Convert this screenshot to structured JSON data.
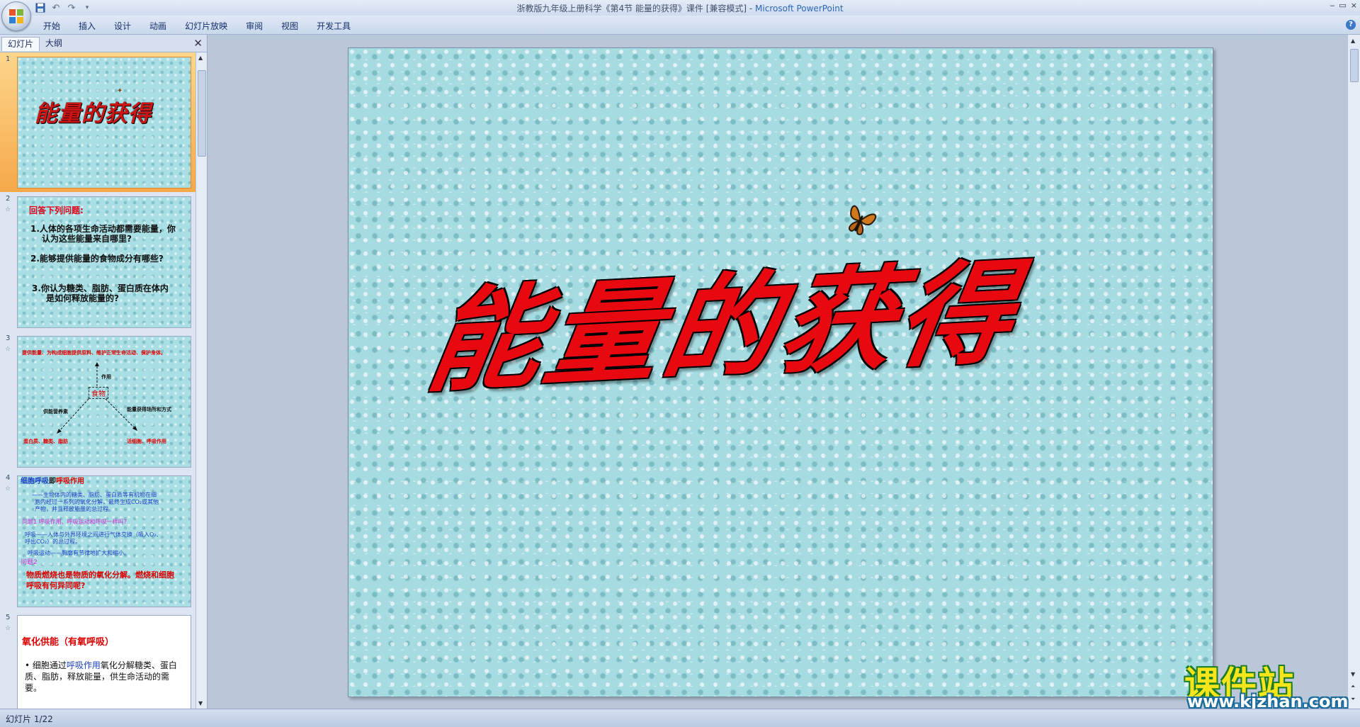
{
  "window": {
    "title": "浙教版九年级上册科学《第4节 能量的获得》课件 [兼容模式] - ",
    "app_name": "Microsoft PowerPoint",
    "controls": [
      "‒",
      "▭",
      "×"
    ]
  },
  "quick_access": {
    "save_icon": "save-icon",
    "undo_icon": "undo-icon",
    "redo_icon": "redo-icon",
    "customize_icon": "dropdown-icon"
  },
  "ribbon": {
    "tabs": [
      "开始",
      "插入",
      "设计",
      "动画",
      "幻灯片放映",
      "审阅",
      "视图",
      "开发工具"
    ]
  },
  "left_pane": {
    "tab_slides": "幻灯片",
    "tab_outline": "大纲",
    "slides": [
      {
        "number": "1",
        "title": "能量的获得"
      },
      {
        "number": "2",
        "heading": "回答下列问题:",
        "q1": "1.人体的各项生命活动都需要能量，你",
        "q1b": "认为这些能量来自哪里?",
        "q2": "2.能够提供能量的食物成分有哪些?",
        "q3": "3.你认为糖类、脂肪、蛋白质在体内",
        "q3b": "是如何释放能量的?"
      },
      {
        "number": "3",
        "top": "提供能量、为构成细胞提供原料、维护正常生命活动、保护身体。",
        "role": "作用",
        "center": "食物",
        "left_label": "供能营养素",
        "right_label": "能量获得场所和方式",
        "left_items": "蛋白质、糖类、脂肪",
        "right_items": "活细胞、呼吸作用"
      },
      {
        "number": "4",
        "l1a": "细胞呼吸",
        "l1b": "即",
        "l1c": "呼吸作用",
        "l2": "——生物体内的糖类、脂肪、蛋白质等有机物在细",
        "l3": "胞内经过一系列的氧化分解，最终生成CO₂或其他",
        "l4": "产物，并且释放能量的总过程。",
        "l5": "问题1  呼吸作用、呼吸运动和呼吸一样吗?",
        "l6": "呼吸——人体与外界环境之间进行气体交换（吸入O₂、",
        "l7": "呼出CO₂）的总过程。",
        "l8": "呼吸运动——胸廓有节律地扩大和缩小。",
        "l9": "问题2",
        "l10": "物质燃烧也是物质的氧化分解。燃烧和细胞",
        "l11": "呼吸有何异同呢?"
      },
      {
        "number": "5",
        "heading": "氧化供能（有氧呼吸）",
        "body_a": "• 细胞通过",
        "body_b": "呼吸作用",
        "body_c": "氧化分解糖类、蛋白质、脂肪，释放能量，供生命活动的需要。"
      }
    ]
  },
  "slide": {
    "title": "能量的获得"
  },
  "watermark": {
    "title": "课件站",
    "url": "www.kjzhan.com"
  },
  "status": {
    "slide_indicator": "幻灯片 1/22"
  },
  "colors": {
    "slide_background": "#a5dbe1",
    "title_red": "#e8080f",
    "selection_orange": "#f6a94a"
  }
}
